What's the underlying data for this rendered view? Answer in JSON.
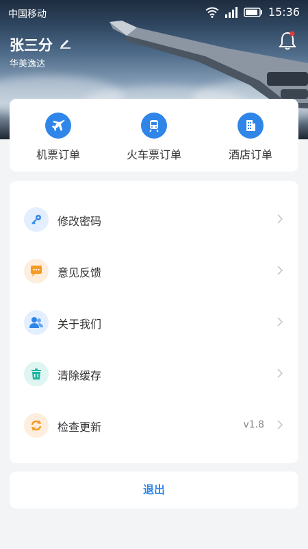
{
  "status_bar": {
    "carrier": "中国移动",
    "time": "15:36"
  },
  "user": {
    "name": "张三分",
    "company": "华美逸达"
  },
  "orders": [
    {
      "label": "机票订单",
      "icon": "airplane-icon"
    },
    {
      "label": "火车票订单",
      "icon": "train-icon"
    },
    {
      "label": "酒店订单",
      "icon": "hotel-icon"
    }
  ],
  "menu": [
    {
      "label": "修改密码",
      "icon": "key-icon"
    },
    {
      "label": "意见反馈",
      "icon": "feedback-icon"
    },
    {
      "label": "关于我们",
      "icon": "about-icon"
    },
    {
      "label": "清除缓存",
      "icon": "trash-icon"
    },
    {
      "label": "检查更新",
      "icon": "refresh-icon",
      "value": "v1.8"
    }
  ],
  "logout_label": "退出",
  "colors": {
    "accent": "#2f86e8",
    "page_bg": "#f3f4f6"
  }
}
